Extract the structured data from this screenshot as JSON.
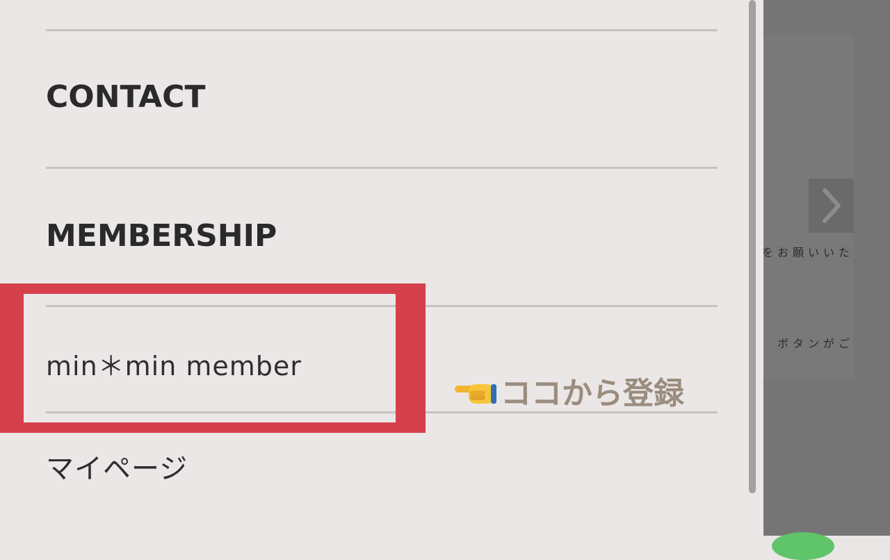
{
  "menu": {
    "contact_label": "CONTACT",
    "membership_label": "MEMBERSHIP",
    "member_link": "min＊min member",
    "mypage_link": "マイページ"
  },
  "annotation": {
    "text": "ココから登録",
    "icon": "pointing-hand-icon",
    "color": "#9a8c7e"
  },
  "highlight_color": "#d5404b",
  "background_page": {
    "snippet_1": "をお願いいた",
    "snippet_2": "ボタンがご",
    "next_icon": "chevron-right-icon"
  }
}
